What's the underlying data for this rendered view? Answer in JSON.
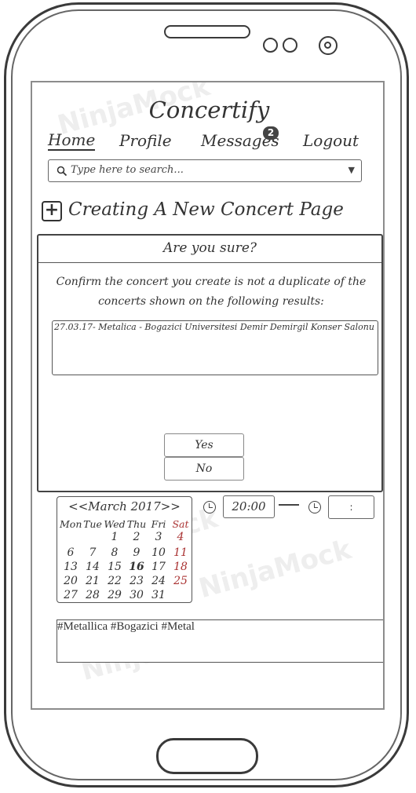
{
  "app": {
    "title": "Concertify"
  },
  "nav": {
    "home": "Home",
    "profile": "Profile",
    "messages": "Messages",
    "messages_badge": "2",
    "logout": "Logout"
  },
  "search": {
    "placeholder": "Type here to search..."
  },
  "page": {
    "heading": "Creating A New Concert Page"
  },
  "dialog": {
    "title": "Are you sure?",
    "message": "Confirm the concert you create is not a duplicate of the concerts shown on the following results:",
    "results": [
      "27.03.17- Metalica - Bogazici Universitesi Demir Demirgil Konser Salonu"
    ],
    "yes_label": "Yes",
    "no_label": "No"
  },
  "calendar": {
    "header": "<<March 2017>>",
    "weekdays": [
      "Mon",
      "Tue",
      "Wed",
      "Thu",
      "Fri",
      "Sat"
    ],
    "weeks": [
      [
        "",
        "",
        "1",
        "2",
        "3",
        "4"
      ],
      [
        "6",
        "7",
        "8",
        "9",
        "10",
        "11"
      ],
      [
        "13",
        "14",
        "15",
        "16",
        "17",
        "18"
      ],
      [
        "20",
        "21",
        "22",
        "23",
        "24",
        "25"
      ],
      [
        "27",
        "28",
        "29",
        "30",
        "31",
        ""
      ]
    ],
    "selected_day": "16",
    "weekend_color": "#a33333"
  },
  "time": {
    "start": "20:00",
    "end": ":"
  },
  "tags": {
    "value": "#Metallica #Bogazici #Metal"
  },
  "watermark": "NinjaMock"
}
